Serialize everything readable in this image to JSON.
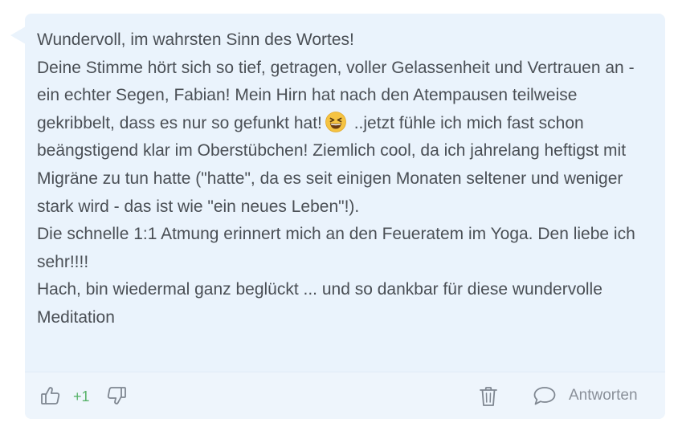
{
  "comment": {
    "paragraph_1": "Wundervoll, im wahrsten Sinn des Wortes!\nDeine Stimme hört sich so tief, getragen, voller Gelassenheit und Vertrauen an - ein echter Segen, Fabian! Mein Hirn hat nach den Atempausen teilweise gekribbelt, dass es nur so gefunkt hat!",
    "emoji": "grinning-squinting-face-icon",
    "paragraph_2": " ..jetzt fühle ich mich fast schon beängstigend klar im Oberstübchen! Ziemlich cool, da ich jahrelang heftigst mit Migräne zu tun hatte (\"hatte\", da es seit einigen Monaten seltener und weniger stark wird - das ist wie \"ein neues Leben\"!).\nDie schnelle 1:1 Atmung erinnert mich an den Feueratem im Yoga. Den liebe ich sehr!!!!\nHach, bin wiedermal ganz beglückt ... und so dankbar für diese wundervolle Meditation"
  },
  "footer": {
    "vote_count": "+1",
    "like_icon": "thumbs-up-icon",
    "dislike_icon": "thumbs-down-icon",
    "delete_icon": "trash-icon",
    "reply_icon": "speech-bubble-icon",
    "reply_label": "Antworten"
  },
  "colors": {
    "bubble_background": "#eaf3fc",
    "text": "#4a4f55",
    "icon": "#7f8791",
    "vote_positive": "#58b36a",
    "emoji_face": "#f5c342"
  }
}
